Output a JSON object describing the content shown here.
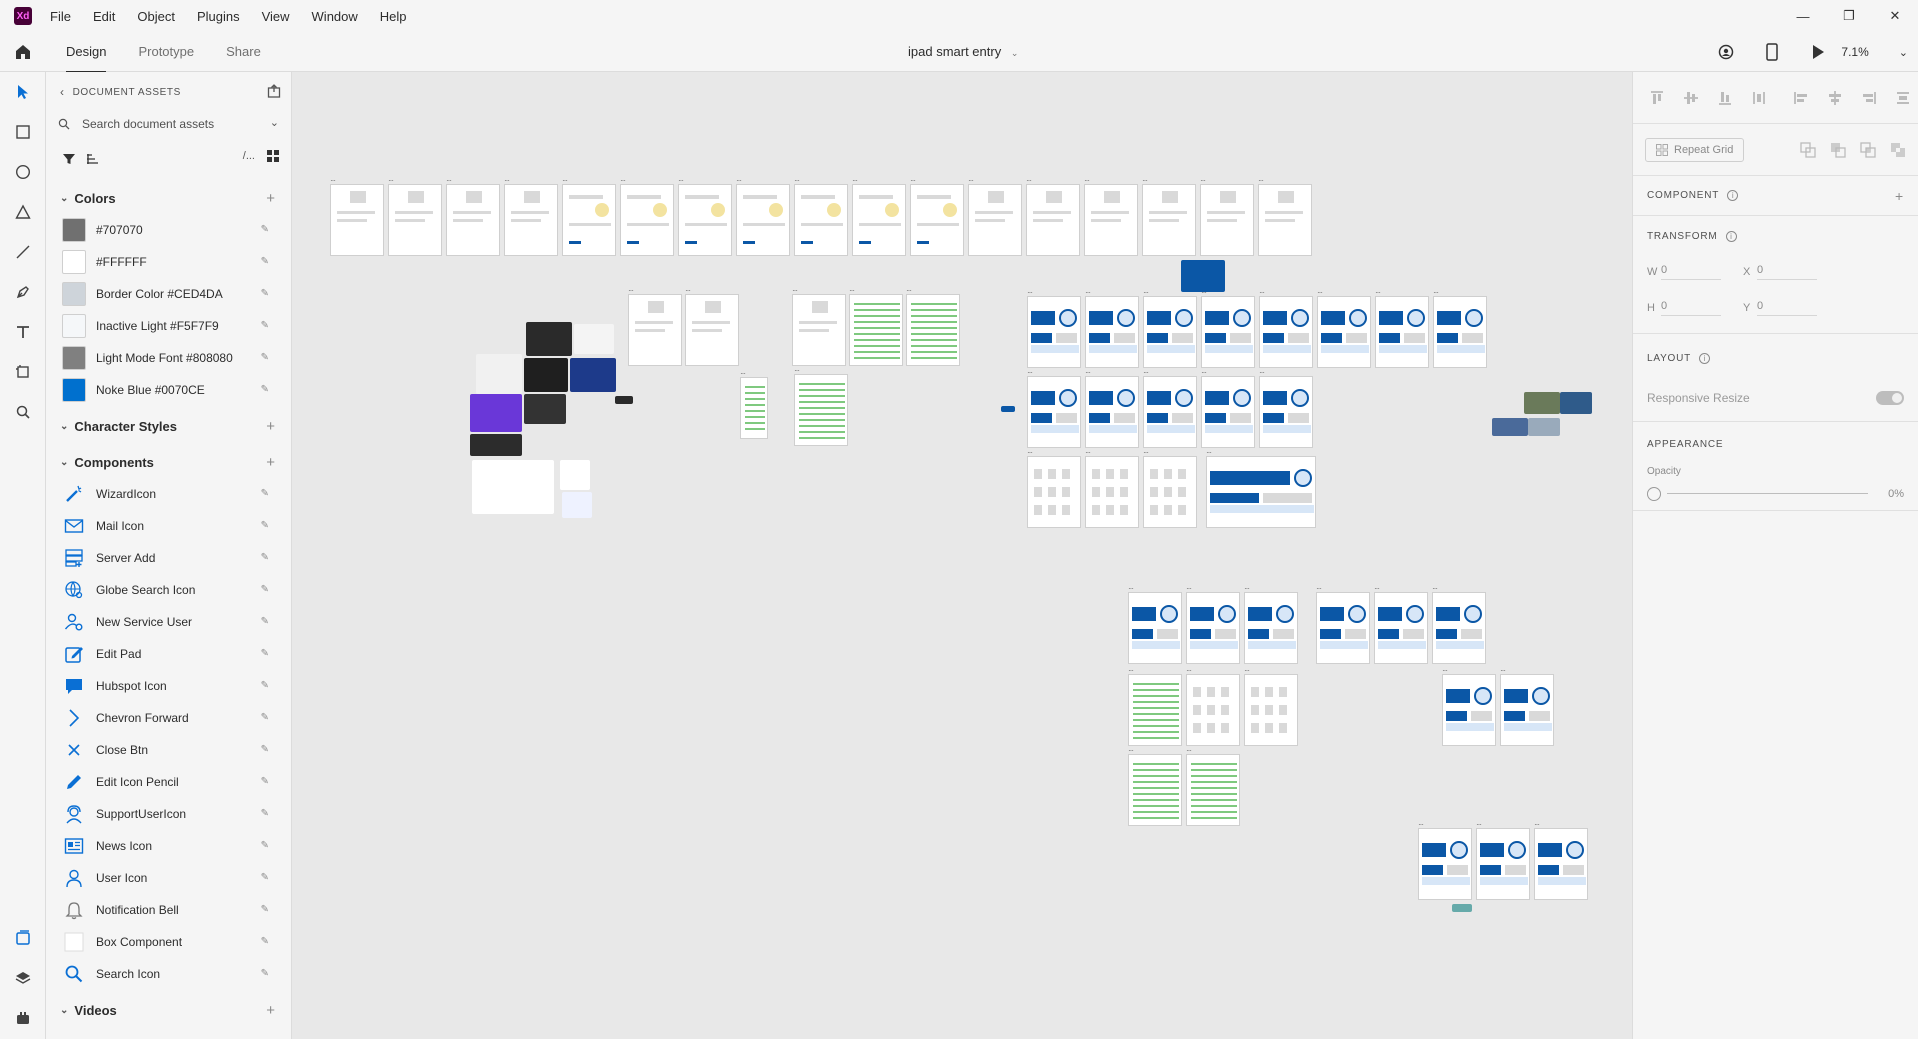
{
  "app": {
    "logo_text": "Xd",
    "menu": [
      "File",
      "Edit",
      "Object",
      "Plugins",
      "View",
      "Window",
      "Help"
    ],
    "window_controls": [
      "—",
      "❐",
      "✕"
    ]
  },
  "tabs": [
    "Design",
    "Prototype",
    "Share"
  ],
  "document_title": "ipad smart entry",
  "zoom": "7.1%",
  "assets": {
    "header": "DOCUMENT ASSETS",
    "search_placeholder": "Search document assets",
    "sections": {
      "colors": "Colors",
      "character_styles": "Character Styles",
      "components": "Components",
      "videos": "Videos"
    },
    "colors": [
      {
        "label": "#707070",
        "hex": "#707070"
      },
      {
        "label": "#FFFFFF",
        "hex": "#FFFFFF"
      },
      {
        "label": "Border Color #CED4DA",
        "hex": "#CED4DA"
      },
      {
        "label": "Inactive Light #F5F7F9",
        "hex": "#F5F7F9"
      },
      {
        "label": "Light Mode Font #808080",
        "hex": "#808080"
      },
      {
        "label": "Noke Blue #0070CE",
        "hex": "#0070CE"
      }
    ],
    "components": [
      {
        "label": "WizardIcon",
        "icon": "wand-icon"
      },
      {
        "label": "Mail Icon",
        "icon": "mail-icon"
      },
      {
        "label": "Server Add",
        "icon": "server-icon"
      },
      {
        "label": "Globe Search Icon",
        "icon": "globe-icon"
      },
      {
        "label": "New Service User",
        "icon": "user-gear-icon"
      },
      {
        "label": "Edit Pad",
        "icon": "edit-pad-icon"
      },
      {
        "label": "Hubspot Icon",
        "icon": "chat-icon"
      },
      {
        "label": "Chevron Forward",
        "icon": "chevron-right-icon"
      },
      {
        "label": "Close Btn",
        "icon": "close-icon"
      },
      {
        "label": "Edit Icon Pencil",
        "icon": "pencil-icon"
      },
      {
        "label": "SupportUserIcon",
        "icon": "support-user-icon"
      },
      {
        "label": "News Icon",
        "icon": "news-icon"
      },
      {
        "label": "User Icon",
        "icon": "user-icon"
      },
      {
        "label": "Notification Bell",
        "icon": "bell-icon"
      },
      {
        "label": "Box Component",
        "icon": "box-icon"
      },
      {
        "label": "Search Icon",
        "icon": "search-icon"
      }
    ]
  },
  "props": {
    "repeat_grid": "Repeat Grid",
    "component": "COMPONENT",
    "transform": "TRANSFORM",
    "w_label": "W",
    "w_value": "0",
    "x_label": "X",
    "x_value": "0",
    "h_label": "H",
    "h_value": "0",
    "y_label": "Y",
    "y_value": "0",
    "layout": "LAYOUT",
    "responsive_resize": "Responsive Resize",
    "appearance": "APPEARANCE",
    "opacity_label": "Opacity",
    "opacity_value": "0%"
  },
  "colors": {
    "accent_blue": "#0070CE",
    "artboard_blue": "#0B57A6",
    "xd_logo_bg": "#470137",
    "xd_logo_fg": "#FF61F6"
  }
}
